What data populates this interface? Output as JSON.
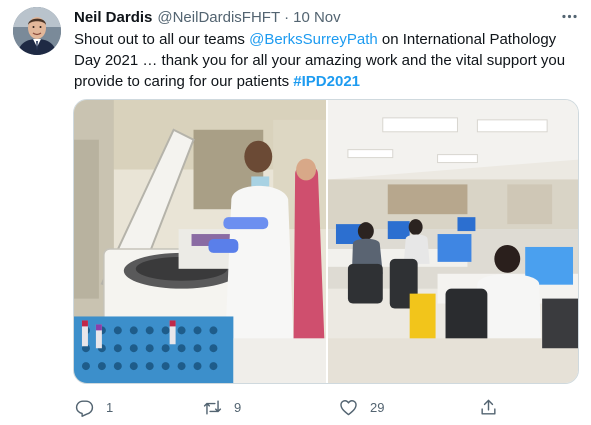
{
  "tweet": {
    "author_name": "Neil Dardis",
    "author_handle": "@NeilDardisFHFT",
    "separator": "·",
    "timestamp": "10 Nov",
    "text_part1": "Shout out to all our teams ",
    "mention": "@BerksSurreyPath",
    "text_part2": " on International Pathology Day 2021 … thank you for all your amazing work and the vital support you provide to caring for our patients ",
    "hashtag": "#IPD2021"
  },
  "actions": {
    "reply_count": "1",
    "retweet_count": "9",
    "like_count": "29"
  },
  "icons": {
    "more": "more-horizontal-icon",
    "reply": "reply-icon",
    "retweet": "retweet-icon",
    "like": "heart-icon",
    "share": "share-icon"
  },
  "colors": {
    "link": "#1d9bf0",
    "text": "#0f1419",
    "muted": "#536471"
  }
}
